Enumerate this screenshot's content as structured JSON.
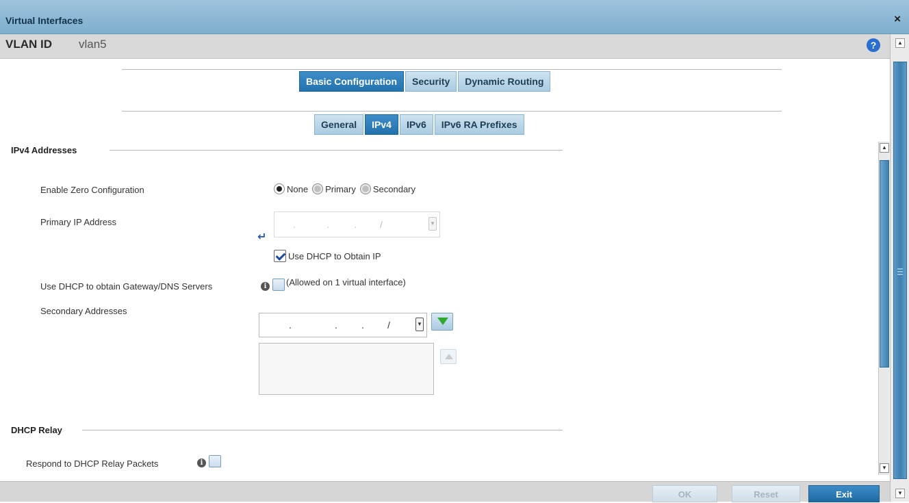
{
  "window": {
    "title": "Virtual Interfaces",
    "close_label": "×"
  },
  "vlan": {
    "label": "VLAN ID",
    "value": "vlan5"
  },
  "help_label": "?",
  "main_tabs": [
    {
      "label": "Basic Configuration",
      "active": true
    },
    {
      "label": "Security",
      "active": false
    },
    {
      "label": "Dynamic Routing",
      "active": false
    }
  ],
  "sub_tabs": [
    {
      "label": "General",
      "active": false
    },
    {
      "label": "IPv4",
      "active": true
    },
    {
      "label": "IPv6",
      "active": false
    },
    {
      "label": "IPv6 RA Prefixes",
      "active": false
    }
  ],
  "ipv4": {
    "section_title": "IPv4 Addresses",
    "zero_config": {
      "label": "Enable Zero Configuration",
      "options": [
        "None",
        "Primary",
        "Secondary"
      ],
      "selected": "None"
    },
    "primary_ip": {
      "label": "Primary IP Address",
      "placeholder_segments": [
        ".",
        ".",
        ".",
        "/"
      ],
      "dhcp_label": "Use DHCP to Obtain IP",
      "dhcp_checked": true
    },
    "gateway_dns": {
      "label": "Use DHCP to obtain Gateway/DNS Servers",
      "note": "(Allowed on 1 virtual interface)",
      "checked": false
    },
    "secondary": {
      "label": "Secondary Addresses",
      "placeholder_segments": [
        ".",
        ".",
        ".",
        "/"
      ]
    }
  },
  "dhcp_relay": {
    "section_title": "DHCP Relay",
    "respond_label": "Respond to DHCP Relay Packets",
    "checked": false
  },
  "footer": {
    "ok_label": "OK",
    "reset_label": "Reset",
    "exit_label": "Exit"
  },
  "colors": {
    "accent": "#2272ad",
    "titlebar": "#8db8d6",
    "add_arrow": "#2eaa2e"
  },
  "icons": {
    "close": "close-icon",
    "help": "help-icon",
    "info": "info-icon",
    "add": "add-arrow-icon",
    "remove": "remove-arrow-icon",
    "dropdown": "chevron-down-icon",
    "ip-entry": "enter-arrow-icon"
  }
}
